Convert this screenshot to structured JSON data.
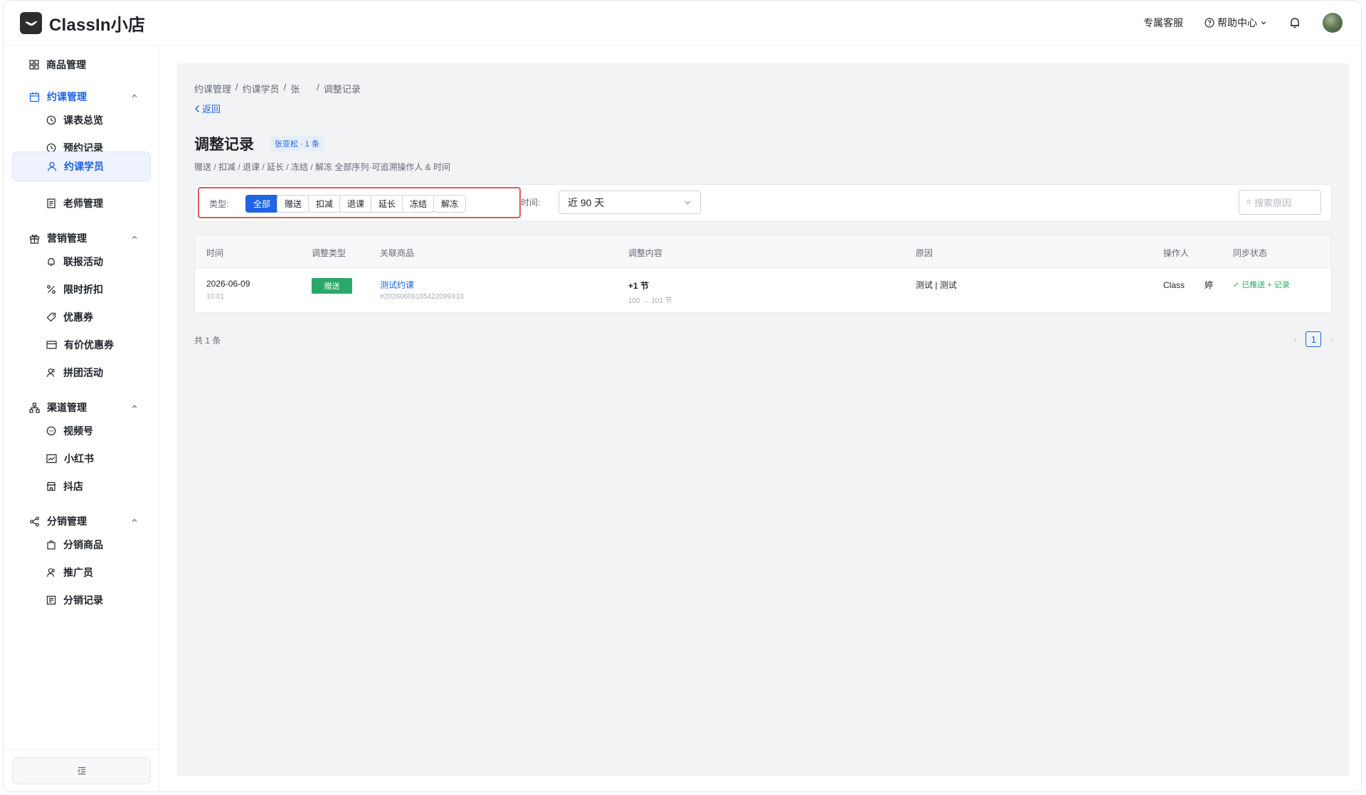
{
  "app": {
    "name": "ClassIn小店"
  },
  "header": {
    "service": "专属客服",
    "help": "帮助中心"
  },
  "sidebar": {
    "groups": [
      {
        "label": "商品管理"
      },
      {
        "label": "约课管理"
      },
      {
        "label": "营销管理"
      },
      {
        "label": "渠道管理"
      },
      {
        "label": "分销管理"
      }
    ],
    "items": {
      "schedule_overview": "课表总览",
      "booking_records": "预约记录",
      "booking_students": "约课学员",
      "teacher_management": "老师管理",
      "joint_signup": "联报活动",
      "flash_discount": "限时折扣",
      "coupon": "优惠券",
      "paid_coupon": "有价优惠券",
      "group_buy": "拼团活动",
      "channels": "视频号",
      "xiaohongshu": "小红书",
      "douyin": "抖店",
      "dist_products": "分销商品",
      "promoters": "推广员",
      "dist_records": "分销记录"
    },
    "active_item": "约课学员"
  },
  "main": {
    "breadcrumb": [
      "约课管理",
      "/",
      "约课学员",
      "/",
      "张",
      "/",
      "调整记录"
    ],
    "back": "返回",
    "title": "调整记录",
    "badge": "张亚松 · 1 条",
    "subtitle": "赠送 / 扣减 / 退课 / 延长 / 冻结 / 解冻 全部序列·可追溯操作人 & 时间",
    "filter": {
      "type_label": "类型:",
      "types": [
        "全部",
        "赠送",
        "扣减",
        "退课",
        "延长",
        "冻结",
        "解冻"
      ],
      "active_type": "全部",
      "time_label": "时间:",
      "time_value": "近 90 天",
      "search_placeholder": "搜索原因"
    },
    "table": {
      "columns": [
        "时间",
        "调整类型",
        "关联商品",
        "调整内容",
        "原因",
        "操作人",
        "同步状态"
      ],
      "rows": [
        {
          "date": "2026-06-09",
          "time": "10:01",
          "type": "赠送",
          "product": "测试约课",
          "product_id": "#20260608185422099X10",
          "change": "+1 节",
          "change_detail": "100 → 101 节",
          "reason": "测试 | 测试",
          "operator_prefix": "Class",
          "operator_suffix": "婷",
          "sync": "✓ 已推送 + 记录"
        }
      ]
    },
    "total": "共 1 条",
    "pagination": {
      "current": "1"
    }
  },
  "colors": {
    "accent": "#1f63e6",
    "success": "#2aa868",
    "highlight_border": "#e05a56"
  }
}
